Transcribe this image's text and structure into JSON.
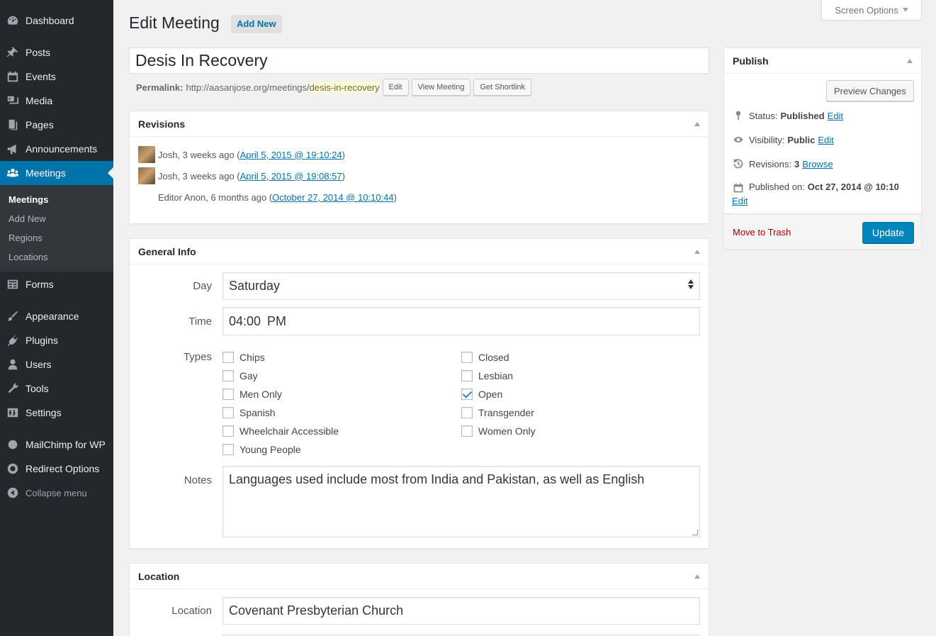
{
  "sidebar": {
    "items": [
      {
        "label": "Dashboard",
        "icon": "dashboard-icon"
      },
      {
        "label": "Posts",
        "icon": "pin-icon"
      },
      {
        "label": "Events",
        "icon": "calendar-icon"
      },
      {
        "label": "Media",
        "icon": "media-icon"
      },
      {
        "label": "Pages",
        "icon": "page-icon"
      },
      {
        "label": "Announcements",
        "icon": "megaphone-icon"
      },
      {
        "label": "Meetings",
        "icon": "group-icon"
      },
      {
        "label": "Forms",
        "icon": "form-icon"
      },
      {
        "label": "Appearance",
        "icon": "brush-icon"
      },
      {
        "label": "Plugins",
        "icon": "plugin-icon"
      },
      {
        "label": "Users",
        "icon": "user-icon"
      },
      {
        "label": "Tools",
        "icon": "wrench-icon"
      },
      {
        "label": "Settings",
        "icon": "settings-icon"
      },
      {
        "label": "MailChimp for WP",
        "icon": "mailchimp-icon"
      },
      {
        "label": "Redirect Options",
        "icon": "redirect-icon"
      },
      {
        "label": "Collapse menu",
        "icon": "collapse-icon"
      }
    ],
    "submenu": [
      "Meetings",
      "Add New",
      "Regions",
      "Locations"
    ]
  },
  "header": {
    "title": "Edit Meeting",
    "add_new": "Add New",
    "screen_options": "Screen Options"
  },
  "post": {
    "title": "Desis In Recovery",
    "permalink_label": "Permalink:",
    "permalink_base": "http://aasanjose.org/meetings/",
    "permalink_slug": "desis-in-recovery",
    "edit_btn": "Edit",
    "view_btn": "View Meeting",
    "shortlink_btn": "Get Shortlink"
  },
  "revisions": {
    "title": "Revisions",
    "rows": [
      {
        "author": "Josh, 3 weeks ago (",
        "link": "April 5, 2015 @ 19:10:24",
        "end": ")"
      },
      {
        "author": "Josh, 3 weeks ago (",
        "link": "April 5, 2015 @ 19:08:57",
        "end": ")"
      },
      {
        "author": "Editor Anon, 6 months ago (",
        "link": "October 27, 2014 @ 10:10:44",
        "end": ")"
      }
    ]
  },
  "general": {
    "title": "General Info",
    "day_label": "Day",
    "day_value": "Saturday",
    "time_label": "Time",
    "time_value": "04:00 PM",
    "types_label": "Types",
    "types_left": [
      {
        "label": "Chips",
        "checked": false
      },
      {
        "label": "Gay",
        "checked": false
      },
      {
        "label": "Men Only",
        "checked": false
      },
      {
        "label": "Spanish",
        "checked": false
      },
      {
        "label": "Wheelchair Accessible",
        "checked": false
      },
      {
        "label": "Young People",
        "checked": false
      }
    ],
    "types_right": [
      {
        "label": "Closed",
        "checked": false
      },
      {
        "label": "Lesbian",
        "checked": false
      },
      {
        "label": "Open",
        "checked": true
      },
      {
        "label": "Transgender",
        "checked": false
      },
      {
        "label": "Women Only",
        "checked": false
      }
    ],
    "notes_label": "Notes",
    "notes_value": "Languages used include most from India and Pakistan, as well as English"
  },
  "location": {
    "title": "Location",
    "label": "Location",
    "value": "Covenant Presbyterian Church"
  },
  "publish": {
    "title": "Publish",
    "preview": "Preview Changes",
    "status_label": "Status:",
    "status_value": "Published",
    "visibility_label": "Visibility:",
    "visibility_value": "Public",
    "revisions_label": "Revisions:",
    "revisions_value": "3",
    "browse": "Browse",
    "published_label": "Published on:",
    "published_value": "Oct 27, 2014 @ 10:10",
    "edit": "Edit",
    "trash": "Move to Trash",
    "update": "Update"
  },
  "colors": {
    "sidebar_bg": "#23282d",
    "active": "#0073aa",
    "primary_button": "#0085ba",
    "trash": "#aa0000"
  }
}
